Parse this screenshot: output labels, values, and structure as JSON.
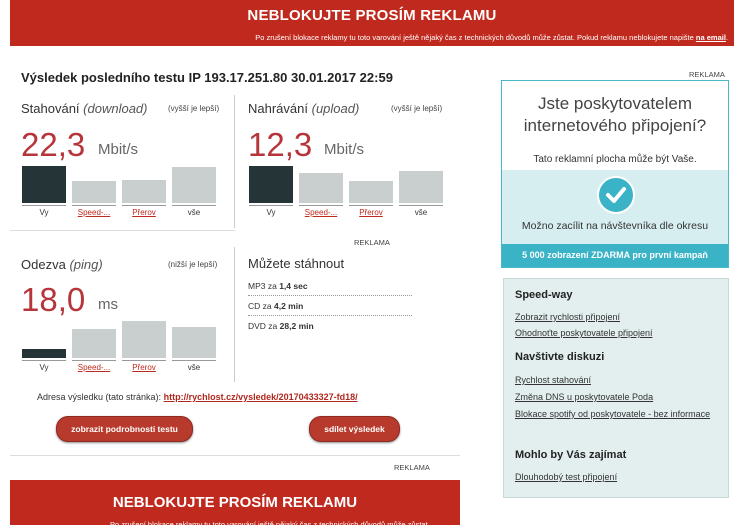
{
  "banner": {
    "title": "NEBLOKUJTE PROSÍM REKLAMU",
    "subtitle": "Po zrušení blokace reklamy tu toto varování ještě nějaký čas z technických důvodů může zůstat. Pokud reklamu neblokujete napište",
    "subtitle_link": "na email"
  },
  "result": {
    "title": "Výsledek posledního testu IP 193.17.251.80 30.01.2017 22:59",
    "reklama": "REKLAMA"
  },
  "download": {
    "label": "Stahování",
    "label_em": "(download)",
    "hint": "(vyšší je lepší)",
    "value": "22,3",
    "unit": "Mbit/s",
    "bars": [
      {
        "label": "Vy",
        "value": 1.0,
        "dark": true,
        "link": false
      },
      {
        "label": "Speed-...",
        "value": 0.6,
        "dark": false,
        "link": true
      },
      {
        "label": "Přerov",
        "value": 0.63,
        "dark": false,
        "link": true
      },
      {
        "label": "vše",
        "value": 0.97,
        "dark": false,
        "link": false
      }
    ]
  },
  "upload": {
    "label": "Nahrávání",
    "label_em": "(upload)",
    "hint": "(vyšší je lepší)",
    "value": "12,3",
    "unit": "Mbit/s",
    "bars": [
      {
        "label": "Vy",
        "value": 1.0,
        "dark": true,
        "link": false
      },
      {
        "label": "Speed-...",
        "value": 0.81,
        "dark": false,
        "link": true
      },
      {
        "label": "Přerov",
        "value": 0.6,
        "dark": false,
        "link": true
      },
      {
        "label": "vše",
        "value": 0.86,
        "dark": false,
        "link": false
      }
    ]
  },
  "ping": {
    "label": "Odezva",
    "label_em": "(ping)",
    "hint": "(nižší je lepší)",
    "value": "18,0",
    "unit": "ms",
    "bars": [
      {
        "label": "Vy",
        "value": 0.24,
        "dark": true,
        "link": false
      },
      {
        "label": "Speed-...",
        "value": 0.78,
        "dark": false,
        "link": true
      },
      {
        "label": "Přerov",
        "value": 1.0,
        "dark": false,
        "link": true
      },
      {
        "label": "vše",
        "value": 0.84,
        "dark": false,
        "link": false
      }
    ]
  },
  "downloads": {
    "title": "Můžete stáhnout",
    "reklama": "REKLAMA",
    "items": [
      {
        "label": "MP3 za",
        "value": "1,4 sec"
      },
      {
        "label": "CD za",
        "value": "4,2 min"
      },
      {
        "label": "DVD za",
        "value": "28,2 min"
      }
    ]
  },
  "address": {
    "label": "Adresa výsledku (tato stránka):",
    "url": "http://rychlost.cz/vysledek/20170433327-fd18/"
  },
  "buttons": {
    "details": "zobrazit podrobnosti testu",
    "share": "sdílet výsledek"
  },
  "bottom": {
    "reklama": "REKLAMA",
    "title": "NEBLOKUJTE PROSÍM REKLAMU",
    "subtitle": "Po zrušení blokace reklamy tu toto varování ještě nějaký čas z technických důvodů může zůstat."
  },
  "ad": {
    "reklama": "REKLAMA",
    "heading_line1": "Jste poskytovatelem",
    "heading_line2": "internetového připojení?",
    "sub": "Tato reklamní plocha může být Vaše.",
    "target": "Možno zacílit na návštevníka dle okresu",
    "cta": "5 000 zobrazení ZDARMA pro první kampaň"
  },
  "links": {
    "sections": [
      {
        "title": "Speed-way",
        "items": [
          "Zobrazit rychlosti připojení",
          "Ohodnoťte poskytovatele připojení"
        ]
      },
      {
        "title": "Navštivte diskuzi",
        "items": [
          "Rychlost stahování",
          "Změna DNS u poskytovatele Poda",
          "Blokace spotify od poskytovatele - bez informace"
        ]
      },
      {
        "title": "Mohlo by Vás zajímat",
        "items": [
          "Dlouhodobý test připojení"
        ]
      }
    ]
  },
  "colors": {
    "accent": "#c0291e",
    "value_red": "#b5353a",
    "teal": "#3ab3c7",
    "bar_dark": "#253436",
    "bar_light": "#c9cfce"
  }
}
